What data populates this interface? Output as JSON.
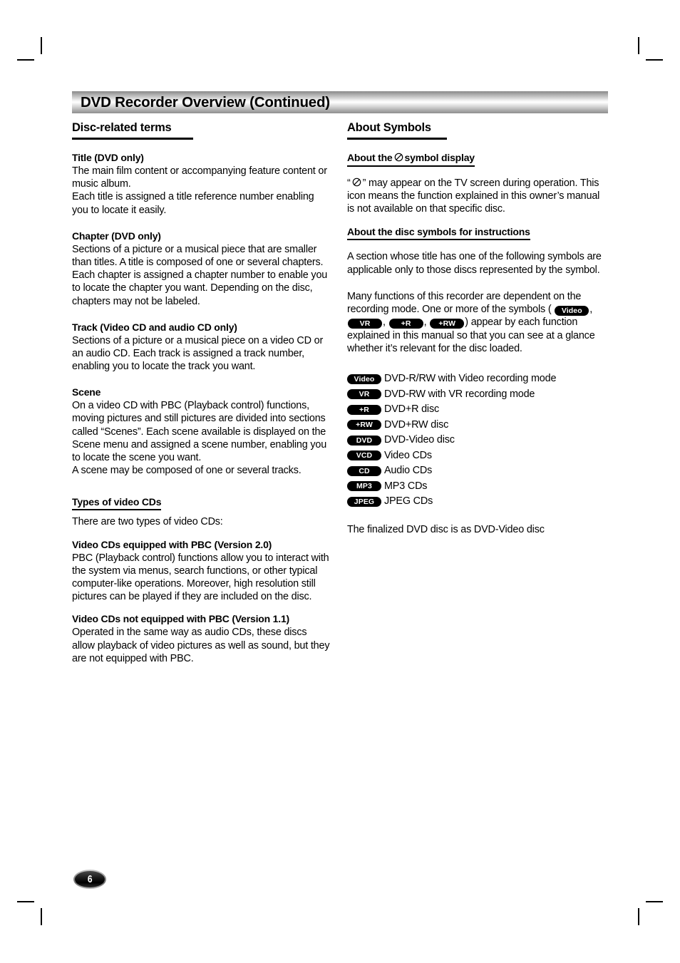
{
  "banner": {
    "title": "DVD Recorder Overview (Continued)"
  },
  "page_number": "6",
  "left_column": {
    "section_title": "Disc-related terms",
    "entries": [
      {
        "heading": "Title (DVD only)",
        "body": "The main film content or accompanying feature content or music album.\nEach title is assigned a title reference number enabling you to locate it easily."
      },
      {
        "heading": "Chapter (DVD only)",
        "body": "Sections of a picture or a musical piece that are smaller than titles. A title is composed of one or several chapters. Each chapter is assigned a chapter number to enable you to locate the chapter you want. Depending on the disc, chapters may not be labeled."
      },
      {
        "heading": "Track (Video CD and audio CD only)",
        "body": "Sections of a picture or a musical piece on a video CD or an audio CD. Each track is assigned a track number, enabling you to locate the track you want."
      },
      {
        "heading": "Scene",
        "body": "On a video CD with PBC (Playback control) functions, moving pictures and still pictures are divided into sections called “Scenes”. Each scene available is displayed on the Scene menu and assigned a scene number, enabling you to locate the scene you want.\nA scene may be composed of one or several tracks."
      }
    ],
    "subsection_title": "Types of video CDs",
    "subsection_intro": "There are two types of video CDs:",
    "subsection_entries": [
      {
        "heading": "Video CDs equipped with PBC (Version 2.0)",
        "body": "PBC (Playback control) functions allow you to interact with the system via menus, search functions, or other typical computer-like operations. Moreover, high resolution still pictures can be played if they are included on the disc."
      },
      {
        "heading": "Video CDs not equipped with PBC (Version 1.1)",
        "body": "Operated in the same way as audio CDs, these discs allow playback of video pictures as well as sound, but they are not equipped with PBC."
      }
    ]
  },
  "right_column": {
    "section_title": "About Symbols",
    "symbol_display": {
      "heading_before": "About the",
      "heading_icon": "prohibited-symbol",
      "heading_after": "symbol display",
      "body_part1": "“",
      "body_part2": "” may appear on the TV screen during operation. This icon means the function explained in this owner’s manual is not available on that specific disc."
    },
    "disc_symbols": {
      "heading": "About the disc symbols for instructions",
      "intro": "A section whose title has one of the following symbols are applicable only to those discs represented by the symbol.",
      "many_functions_part1": "Many functions of this recorder are dependent on the recording mode. One or more of the symbols",
      "many_functions_open": "(",
      "inline_badges": [
        "Video",
        "VR",
        "+R",
        "+RW"
      ],
      "many_functions_close": ") appear by each function explained in this manual so that you can see at a glance whether it’s relevant for the disc loaded.",
      "list": [
        {
          "badge": "Video",
          "desc": "DVD-R/RW with Video recording mode"
        },
        {
          "badge": "VR",
          "desc": "DVD-RW with VR recording mode"
        },
        {
          "badge": "+R",
          "desc": "DVD+R disc"
        },
        {
          "badge": "+RW",
          "desc": "DVD+RW disc"
        },
        {
          "badge": "DVD",
          "desc": "DVD-Video disc"
        },
        {
          "badge": "VCD",
          "desc": "Video CDs"
        },
        {
          "badge": "CD",
          "desc": "Audio CDs"
        },
        {
          "badge": "MP3",
          "desc": "MP3 CDs"
        },
        {
          "badge": "JPEG",
          "desc": "JPEG CDs"
        }
      ],
      "footnote": "The finalized DVD disc is as DVD-Video disc"
    }
  }
}
